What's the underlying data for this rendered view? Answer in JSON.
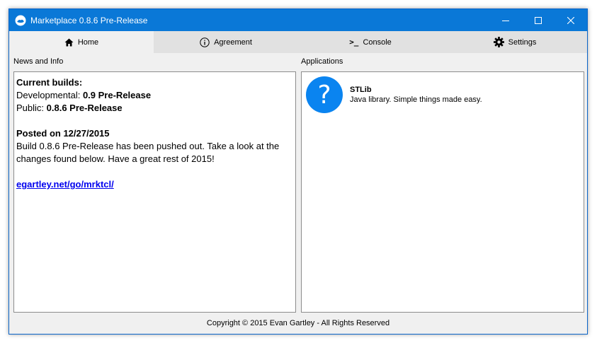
{
  "window": {
    "title": "Marketplace 0.8.6 Pre-Release",
    "accent_color": "#0a78d7",
    "controls": [
      "minimize-icon",
      "maximize-icon",
      "close-icon"
    ]
  },
  "tabs": [
    {
      "label": "Home",
      "icon": "home-icon",
      "active": true
    },
    {
      "label": "Agreement",
      "icon": "info-icon",
      "active": false
    },
    {
      "label": "Console",
      "icon": ">_",
      "active": false
    },
    {
      "label": "Settings",
      "icon": "gear-icon",
      "active": false
    }
  ],
  "news": {
    "section_label": "News and Info",
    "current_builds_heading": "Current builds:",
    "developmental_label": "Developmental:",
    "developmental_value": "0.9 Pre-Release",
    "public_label": "Public:",
    "public_value": "0.8.6 Pre-Release",
    "posted_heading": "Posted on 12/27/2015",
    "body_line1": "Build 0.8.6 Pre-Release has been pushed out. Take a look at the",
    "body_line2": "changes found below. Have a great rest of 2015!",
    "link_text": "egartley.net/go/mrktcl/"
  },
  "applications": {
    "section_label": "Applications",
    "items": [
      {
        "name": "STLib",
        "description": "Java library. Simple things made easy.",
        "icon_glyph": "?",
        "icon_color": "#0a84f0"
      }
    ]
  },
  "footer": {
    "copyright": "Copyright © 2015 Evan Gartley - All Rights Reserved"
  }
}
